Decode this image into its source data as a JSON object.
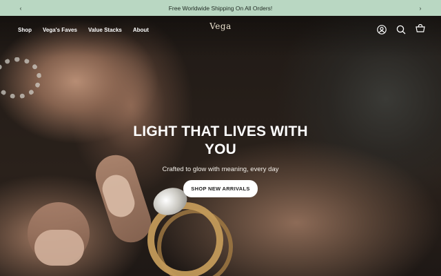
{
  "announcement": {
    "text": "Free Worldwide Shipping On All Orders!",
    "prev_arrow": "‹",
    "next_arrow": "›"
  },
  "header": {
    "logo": "Vega",
    "nav": [
      "Shop",
      "Vega's Faves",
      "Value Stacks",
      "About"
    ],
    "icons": [
      "account-icon",
      "search-icon",
      "cart-icon"
    ]
  },
  "hero": {
    "title": "LIGHT THAT LIVES WITH YOU",
    "subtitle": "Crafted to glow with meaning, every day",
    "cta": "SHOP NEW ARRIVALS"
  },
  "colors": {
    "announcement_bg": "#b9d7c2",
    "cta_bg": "#ffffff",
    "text_on_hero": "#ffffff"
  }
}
